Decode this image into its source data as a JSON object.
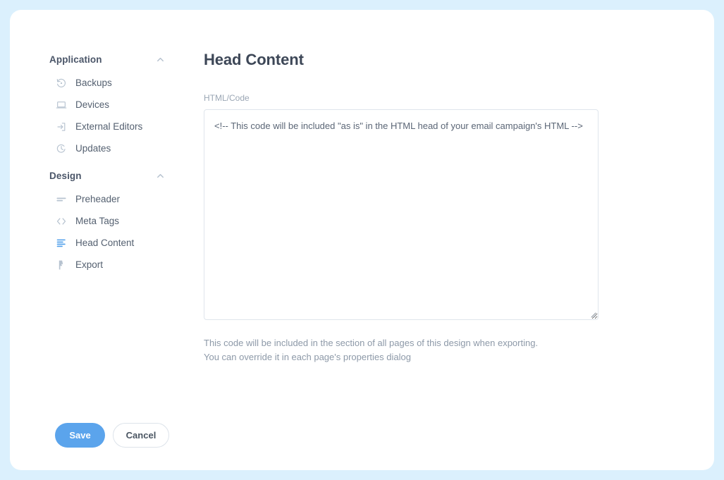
{
  "theme": {
    "page_background": "#dbf0fd",
    "card_background": "#ffffff",
    "accent": "#5ba4ec",
    "active_icon": "#4d9eea",
    "text_primary": "#3d4757",
    "text_muted": "#8d99a8"
  },
  "sidebar": {
    "groups": [
      {
        "title": "Application",
        "collapse_icon": "chevron-up-icon",
        "items": [
          {
            "label": "Backups",
            "icon": "backup-restore-icon",
            "active": false
          },
          {
            "label": "Devices",
            "icon": "laptop-icon",
            "active": false
          },
          {
            "label": "External Editors",
            "icon": "external-editor-icon",
            "active": false
          },
          {
            "label": "Updates",
            "icon": "update-refresh-icon",
            "active": false
          }
        ]
      },
      {
        "title": "Design",
        "collapse_icon": "chevron-up-icon",
        "items": [
          {
            "label": "Preheader",
            "icon": "text-lines-icon",
            "active": false
          },
          {
            "label": "Meta Tags",
            "icon": "code-brackets-icon",
            "active": false
          },
          {
            "label": "Head Content",
            "icon": "align-lines-icon",
            "active": true
          },
          {
            "label": "Export",
            "icon": "lightning-bolt-icon",
            "active": false
          }
        ]
      }
    ]
  },
  "main": {
    "title": "Head Content",
    "field_label": "HTML/Code",
    "code_value": "",
    "code_placeholder": "<!-- This code will be included \"as is\" in the HTML head of your email campaign's HTML -->",
    "help_line_1": "This code will be included in the section of all pages of this design when exporting.",
    "help_line_2": "You can override it in each page's properties dialog"
  },
  "footer": {
    "save_label": "Save",
    "cancel_label": "Cancel"
  }
}
